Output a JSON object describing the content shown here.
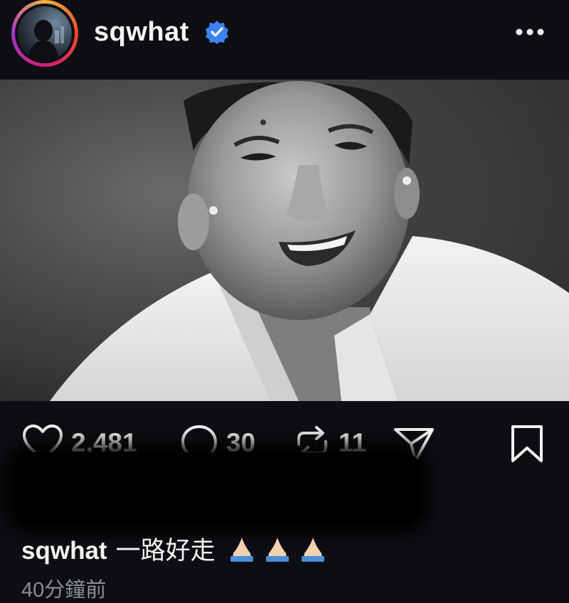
{
  "post": {
    "username": "sqwhat",
    "verified": true,
    "caption_user": "sqwhat",
    "caption_text": "一路好走",
    "caption_emoji": [
      "folded-hands",
      "folded-hands",
      "folded-hands"
    ],
    "timestamp": "40分鐘前"
  },
  "stats": {
    "likes": "2,481",
    "comments": "30",
    "reposts": "11"
  },
  "colors": {
    "background": "#0c0e12",
    "verified_badge": "#3b82f6",
    "text": "#f3f3f3",
    "muted_text": "#8a8d93"
  },
  "icons": [
    "heart-icon",
    "comment-icon",
    "repost-icon",
    "share-icon",
    "bookmark-icon",
    "more-icon",
    "mute-icon",
    "verified-icon"
  ]
}
